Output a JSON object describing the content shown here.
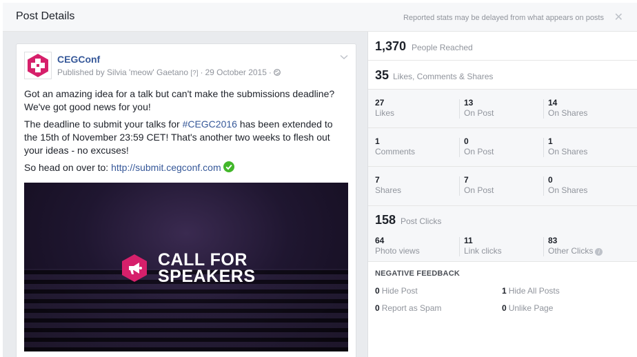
{
  "dialog": {
    "title": "Post Details",
    "note": "Reported stats may be delayed from what appears on posts",
    "close": "✕"
  },
  "post": {
    "page_name": "CEGConf",
    "published_by": "Published by Silvia 'meow' Gaetano",
    "help": "[?]",
    "date": "29 October 2015",
    "paragraphs": [
      "Got an amazing idea for a talk but can't make the submissions deadline? We've got good news for you!"
    ],
    "p2_before": "The deadline to submit your talks for ",
    "p2_hashtag": "#CEGC2016",
    "p2_after": " has been extended to the 15th of November 23:59 CET! That's another two weeks to flesh out your ideas - no excuses!",
    "p3_before": "So head on over to: ",
    "p3_link": "http://submit.cegconf.com",
    "image_caption_line1": "CALL FOR",
    "image_caption_line2": "SPEAKERS"
  },
  "stats": {
    "reach_num": "1,370",
    "reach_label": "People Reached",
    "engage_num": "35",
    "engage_label": "Likes, Comments & Shares",
    "rows": [
      {
        "total": "27",
        "total_label": "Likes",
        "on_post": "13",
        "on_post_label": "On Post",
        "on_shares": "14",
        "on_shares_label": "On Shares"
      },
      {
        "total": "1",
        "total_label": "Comments",
        "on_post": "0",
        "on_post_label": "On Post",
        "on_shares": "1",
        "on_shares_label": "On Shares"
      },
      {
        "total": "7",
        "total_label": "Shares",
        "on_post": "7",
        "on_post_label": "On Post",
        "on_shares": "0",
        "on_shares_label": "On Shares"
      }
    ],
    "clicks_num": "158",
    "clicks_label": "Post Clicks",
    "clicks": {
      "photo": "64",
      "photo_label": "Photo views",
      "link": "11",
      "link_label": "Link clicks",
      "other": "83",
      "other_label": "Other Clicks"
    },
    "negative_title": "NEGATIVE FEEDBACK",
    "negative": {
      "hide_post": "0",
      "hide_post_label": "Hide Post",
      "hide_all": "1",
      "hide_all_label": "Hide All Posts",
      "spam": "0",
      "spam_label": "Report as Spam",
      "unlike": "0",
      "unlike_label": "Unlike Page"
    }
  },
  "colors": {
    "brand_magenta": "#d6206b",
    "link_blue": "#365899",
    "check_green": "#42b72a"
  },
  "icons": [
    "close-icon",
    "chevron-down-icon",
    "globe-icon",
    "check-circle-icon",
    "megaphone-icon",
    "info-icon"
  ]
}
